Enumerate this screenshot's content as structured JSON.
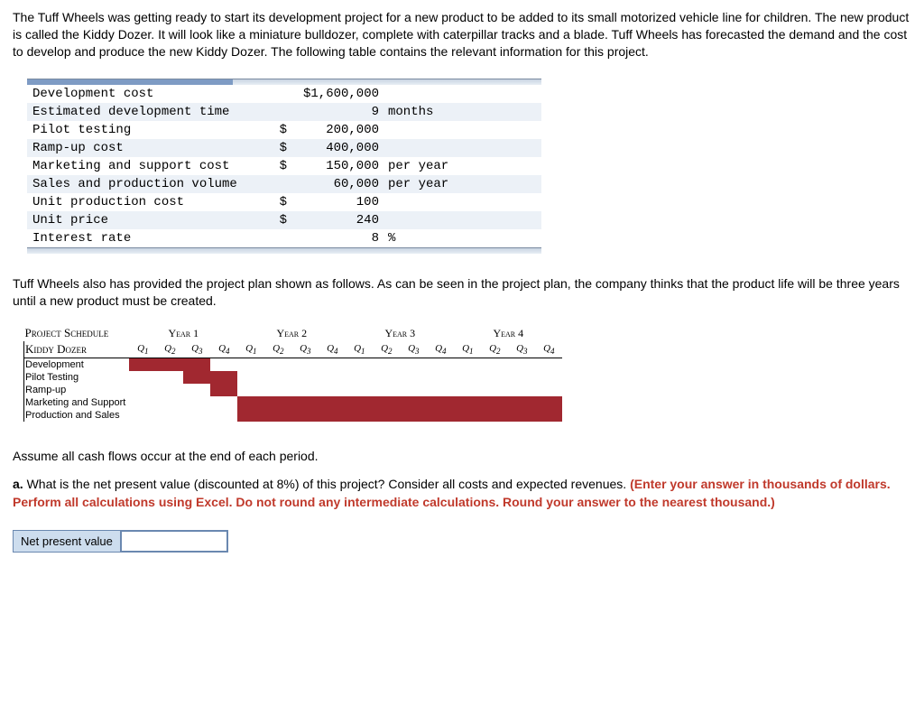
{
  "intro": "The Tuff Wheels was getting ready to start its development project for a new product to be added to its small motorized vehicle line for children. The new product is called the Kiddy Dozer. It will look like a miniature bulldozer, complete with caterpillar tracks and a blade. Tuff Wheels has forecasted the demand and the cost to develop and produce the new Kiddy Dozer. The following table contains the relevant information for this project.",
  "info_rows": [
    {
      "label": "Development cost",
      "cur": "",
      "val": "$1,600,000",
      "unit": ""
    },
    {
      "label": "Estimated development time",
      "cur": "",
      "val": "9",
      "unit": "months"
    },
    {
      "label": "Pilot testing",
      "cur": "$",
      "val": "200,000",
      "unit": ""
    },
    {
      "label": "Ramp-up cost",
      "cur": "$",
      "val": "400,000",
      "unit": ""
    },
    {
      "label": "Marketing and support cost",
      "cur": "$",
      "val": "150,000",
      "unit": "per year"
    },
    {
      "label": "Sales and production volume",
      "cur": "",
      "val": "60,000",
      "unit": "per year"
    },
    {
      "label": "Unit production cost",
      "cur": "$",
      "val": "100",
      "unit": ""
    },
    {
      "label": "Unit price",
      "cur": "$",
      "val": "240",
      "unit": ""
    },
    {
      "label": "Interest rate",
      "cur": "",
      "val": "8",
      "unit": "%"
    }
  ],
  "midtext": "Tuff Wheels also has provided the project plan shown as follows. As can be seen in the project plan, the company thinks that the product life will be three years until a new product must be created.",
  "gantt": {
    "title1": "Project Schedule",
    "title2": "Kiddy Dozer",
    "years": [
      "Year 1",
      "Year 2",
      "Year 3",
      "Year 4"
    ],
    "quarters": [
      "Q1",
      "Q2",
      "Q3",
      "Q4",
      "Q1",
      "Q2",
      "Q3",
      "Q4",
      "Q1",
      "Q2",
      "Q3",
      "Q4",
      "Q1",
      "Q2",
      "Q3",
      "Q4"
    ],
    "rows": [
      {
        "label": "Development",
        "fill": [
          1,
          1,
          1,
          0,
          0,
          0,
          0,
          0,
          0,
          0,
          0,
          0,
          0,
          0,
          0,
          0
        ]
      },
      {
        "label": "Pilot Testing",
        "fill": [
          0,
          0,
          1,
          1,
          0,
          0,
          0,
          0,
          0,
          0,
          0,
          0,
          0,
          0,
          0,
          0
        ]
      },
      {
        "label": "Ramp-up",
        "fill": [
          0,
          0,
          0,
          1,
          0,
          0,
          0,
          0,
          0,
          0,
          0,
          0,
          0,
          0,
          0,
          0
        ]
      },
      {
        "label": "Marketing and Support",
        "fill": [
          0,
          0,
          0,
          0,
          1,
          1,
          1,
          1,
          1,
          1,
          1,
          1,
          1,
          1,
          1,
          1
        ]
      },
      {
        "label": "Production and Sales",
        "fill": [
          0,
          0,
          0,
          0,
          1,
          1,
          1,
          1,
          1,
          1,
          1,
          1,
          1,
          1,
          1,
          1
        ]
      }
    ]
  },
  "assume": "Assume all cash flows occur at the end of each period.",
  "question": {
    "prefix": "a. ",
    "body": "What is the net present value (discounted at 8%) of this project? Consider all costs and expected revenues. ",
    "hint": "(Enter your answer in thousands of dollars. Perform all calculations using Excel. Do not round any intermediate calculations. Round your answer to the nearest thousand.)"
  },
  "answer": {
    "label": "Net present value",
    "value": ""
  }
}
